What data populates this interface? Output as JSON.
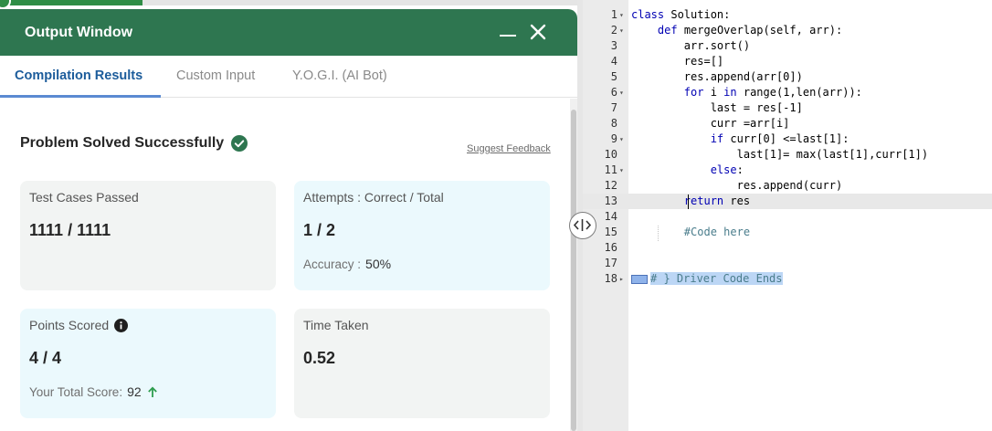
{
  "output_window": {
    "title": "Output Window",
    "tabs": [
      {
        "label": "Compilation Results",
        "active": true
      },
      {
        "label": "Custom Input",
        "active": false
      },
      {
        "label": "Y.O.G.I. (AI Bot)",
        "active": false
      }
    ],
    "status_title": "Problem Solved Successfully",
    "suggest_feedback": "Suggest Feedback",
    "cards": {
      "test_cases": {
        "label": "Test Cases Passed",
        "value": "1111 / 1111"
      },
      "attempts": {
        "label": "Attempts : Correct / Total",
        "value": "1 / 2",
        "sub_label": "Accuracy :",
        "sub_value": "50%"
      },
      "points": {
        "label": "Points Scored",
        "value": "4 / 4",
        "sub_label": "Your Total Score:",
        "sub_value": "92"
      },
      "time": {
        "label": "Time Taken",
        "value": "0.52"
      }
    }
  },
  "editor": {
    "lines": [
      {
        "num": "1",
        "fold": "▾",
        "segments": [
          {
            "t": "kw",
            "v": "class"
          },
          {
            "t": "",
            "v": " Solution:"
          }
        ]
      },
      {
        "num": "2",
        "fold": "▾",
        "segments": [
          {
            "t": "",
            "v": "    "
          },
          {
            "t": "kw",
            "v": "def"
          },
          {
            "t": "",
            "v": " mergeOverlap(self, arr):"
          }
        ]
      },
      {
        "num": "3",
        "fold": "",
        "segments": [
          {
            "t": "",
            "v": "        arr.sort()"
          }
        ]
      },
      {
        "num": "4",
        "fold": "",
        "segments": [
          {
            "t": "",
            "v": "        res=[]"
          }
        ]
      },
      {
        "num": "5",
        "fold": "",
        "segments": [
          {
            "t": "",
            "v": "        res.append(arr[0])"
          }
        ]
      },
      {
        "num": "6",
        "fold": "▾",
        "segments": [
          {
            "t": "",
            "v": "        "
          },
          {
            "t": "kw",
            "v": "for"
          },
          {
            "t": "",
            "v": " i "
          },
          {
            "t": "kw",
            "v": "in"
          },
          {
            "t": "",
            "v": " range(1,len(arr)):"
          }
        ]
      },
      {
        "num": "7",
        "fold": "",
        "segments": [
          {
            "t": "",
            "v": "            last = res[-1]"
          }
        ]
      },
      {
        "num": "8",
        "fold": "",
        "segments": [
          {
            "t": "",
            "v": "            curr =arr[i]"
          }
        ]
      },
      {
        "num": "9",
        "fold": "▾",
        "segments": [
          {
            "t": "",
            "v": "            "
          },
          {
            "t": "kw",
            "v": "if"
          },
          {
            "t": "",
            "v": " curr[0] <=last[1]:"
          }
        ]
      },
      {
        "num": "10",
        "fold": "",
        "segments": [
          {
            "t": "",
            "v": "                last[1]= max(last[1],curr[1])"
          }
        ]
      },
      {
        "num": "11",
        "fold": "▾",
        "segments": [
          {
            "t": "",
            "v": "            "
          },
          {
            "t": "kw",
            "v": "else"
          },
          {
            "t": "",
            "v": ":"
          }
        ]
      },
      {
        "num": "12",
        "fold": "",
        "segments": [
          {
            "t": "",
            "v": "                res.append(curr)"
          }
        ]
      },
      {
        "num": "13",
        "fold": "",
        "segments": [
          {
            "t": "",
            "v": "        "
          },
          {
            "t": "kw",
            "v": "return"
          },
          {
            "t": "",
            "v": " res"
          }
        ],
        "active": true
      },
      {
        "num": "14",
        "fold": "",
        "segments": [
          {
            "t": "",
            "v": ""
          }
        ]
      },
      {
        "num": "15",
        "fold": "",
        "segments": [
          {
            "t": "",
            "v": "        "
          },
          {
            "t": "cm",
            "v": "#Code here"
          }
        ]
      },
      {
        "num": "16",
        "fold": "",
        "segments": [
          {
            "t": "",
            "v": ""
          }
        ]
      },
      {
        "num": "17",
        "fold": "",
        "segments": [
          {
            "t": "",
            "v": ""
          }
        ]
      },
      {
        "num": "18",
        "fold": "▸",
        "segments": [
          {
            "t": "marker",
            "v": ""
          },
          {
            "t": "cm sel",
            "v": "# } Driver Code Ends"
          }
        ]
      }
    ]
  },
  "colors": {
    "header_green": "#2e7650",
    "active_tab_blue": "#1c5c9b",
    "success_green": "#2e7650",
    "keyword_blue": "#0000b3"
  }
}
